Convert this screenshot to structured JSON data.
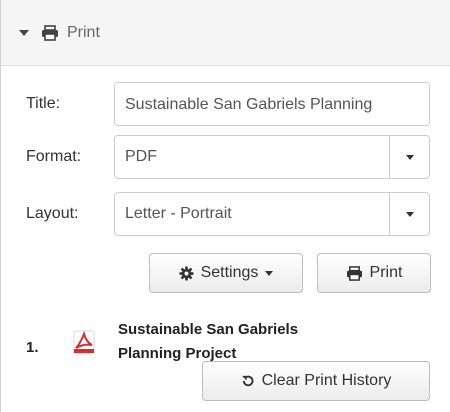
{
  "header": {
    "title": "Print",
    "toggle_icon": "caret-down-icon",
    "icon": "printer-icon"
  },
  "form": {
    "title": {
      "label": "Title:",
      "value": "Sustainable San Gabriels Planning"
    },
    "format": {
      "label": "Format:",
      "value": "PDF"
    },
    "layout": {
      "label": "Layout:",
      "value": "Letter - Portrait"
    }
  },
  "actions": {
    "settings_label": "Settings",
    "print_label": "Print"
  },
  "history": {
    "items": [
      {
        "number": "1.",
        "title": "Sustainable San Gabriels Planning Project",
        "icon": "pdf-file-icon"
      }
    ],
    "clear_label": "Clear Print History"
  }
}
